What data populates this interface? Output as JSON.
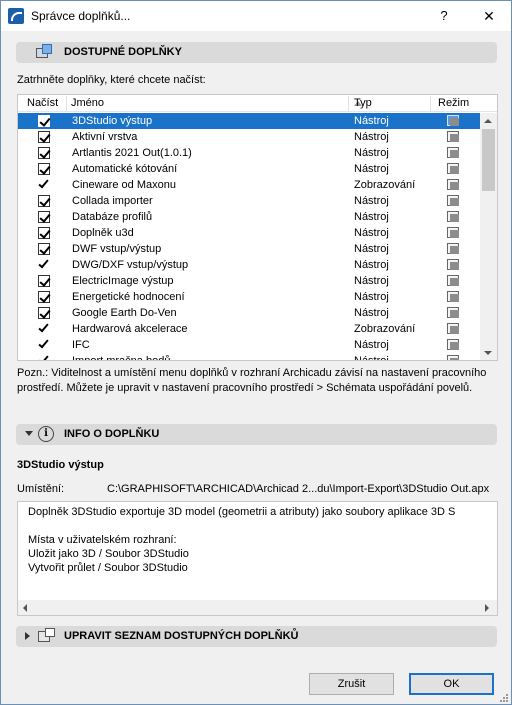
{
  "window": {
    "title": "Správce doplňků...",
    "help_label": "?",
    "close_label": "✕"
  },
  "available": {
    "header": "DOSTUPNÉ DOPLŇKY",
    "instruction": "Zatrhněte doplňky, které chcete načíst:",
    "columns": {
      "load": "Načíst",
      "name": "Jméno",
      "type": "Typ",
      "mode": "Režim"
    },
    "rows": [
      {
        "check": "box",
        "name": "3DStudio výstup",
        "type": "Nástroj",
        "selected": true
      },
      {
        "check": "box",
        "name": "Aktivní vrstva",
        "type": "Nástroj"
      },
      {
        "check": "box",
        "name": "Artlantis 2021 Out(1.0.1)",
        "type": "Nástroj"
      },
      {
        "check": "box",
        "name": "Automatické kótování",
        "type": "Nástroj"
      },
      {
        "check": "tick",
        "name": "Cineware od Maxonu",
        "type": "Zobrazování"
      },
      {
        "check": "box",
        "name": "Collada importer",
        "type": "Nástroj"
      },
      {
        "check": "box",
        "name": "Databáze profilů",
        "type": "Nástroj"
      },
      {
        "check": "box",
        "name": "Doplněk u3d",
        "type": "Nástroj"
      },
      {
        "check": "box",
        "name": "DWF vstup/výstup",
        "type": "Nástroj"
      },
      {
        "check": "tick",
        "name": "DWG/DXF vstup/výstup",
        "type": "Nástroj"
      },
      {
        "check": "box",
        "name": "ElectricImage výstup",
        "type": "Nástroj"
      },
      {
        "check": "box",
        "name": "Energetické hodnocení",
        "type": "Nástroj"
      },
      {
        "check": "box",
        "name": "Google Earth Do-Ven",
        "type": "Nástroj"
      },
      {
        "check": "tick",
        "name": "Hardwarová akcelerace",
        "type": "Zobrazování"
      },
      {
        "check": "tick",
        "name": "IFC",
        "type": "Nástroj"
      },
      {
        "check": "tick",
        "name": "Import mračna bodů",
        "type": "Nástroj"
      }
    ],
    "note": "Pozn.: Viditelnost a umístění menu doplňků v rozhraní Archicadu závisí na nastavení pracovního prostředí. Můžete je upravit v nastavení pracovního prostředí > Schémata uspořádání povelů."
  },
  "info": {
    "header": "INFO O DOPLŇKU",
    "plugin_name": "3DStudio výstup",
    "location_label": "Umístění:",
    "location_value": "C:\\GRAPHISOFT\\ARCHICAD\\Archicad 2...du\\Import-Export\\3DStudio Out.apx",
    "description": "Doplněk 3DStudio exportuje 3D model (geometrii a atributy) jako soubory aplikace 3D S\n\nMísta v uživatelském rozhraní:\nUložit jako 3D / Soubor 3DStudio\nVytvořit průlet / Soubor 3DStudio"
  },
  "edit": {
    "header": "UPRAVIT SEZNAM DOSTUPNÝCH DOPLŇKŮ"
  },
  "buttons": {
    "cancel": "Zrušit",
    "ok": "OK"
  }
}
